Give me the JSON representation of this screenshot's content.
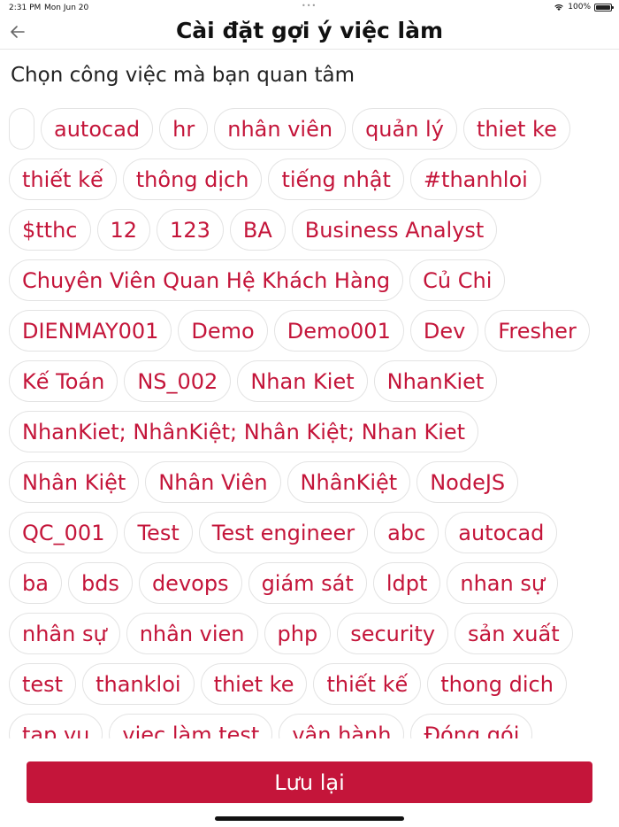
{
  "status_bar": {
    "time": "2:31 PM",
    "date": "Mon Jun 20",
    "battery": "100%",
    "icons": [
      "wifi-icon",
      "battery-icon"
    ]
  },
  "header": {
    "title": "Cài đặt gợi ý việc làm",
    "back_icon": "arrow-left-icon"
  },
  "section_title": "Chọn công việc mà bạn quan tâm",
  "tags": [
    "",
    "autocad",
    "hr",
    "nhân viên",
    "quản lý",
    "thiet ke",
    "thiết kế",
    "thông dịch",
    "tiếng nhật",
    "#thanhloi",
    "$tthc",
    "12",
    "123",
    "BA",
    "Business Analyst",
    "Chuyên Viên Quan Hệ Khách Hàng",
    "Củ Chi",
    "DIENMAY001",
    "Demo",
    "Demo001",
    "Dev",
    "Fresher",
    "Kế Toán",
    "NS_002",
    "Nhan Kiet ",
    "NhanKiet",
    "NhanKiet; NhânKiệt; Nhân Kiệt; Nhan Kiet",
    "Nhân Kiệt",
    "Nhân Viên",
    "NhânKiệt",
    "NodeJS",
    "QC_001",
    "Test",
    "Test engineer",
    "abc",
    "autocad",
    "ba",
    "bds",
    "devops",
    "giám sát",
    "ldpt",
    "nhan sự",
    "nhân sự",
    "nhân vien",
    "php",
    "security",
    "sản xuất",
    "test",
    "thankloi",
    "thiet ke",
    "thiết kế",
    "thong dich",
    "tap vu",
    "viec làm test",
    "vận hành",
    "Đóng gói"
  ],
  "save_button_label": "Lưu lại",
  "colors": {
    "accent": "#c4153a",
    "tag_border": "#e3e3e3",
    "text": "#222222"
  }
}
